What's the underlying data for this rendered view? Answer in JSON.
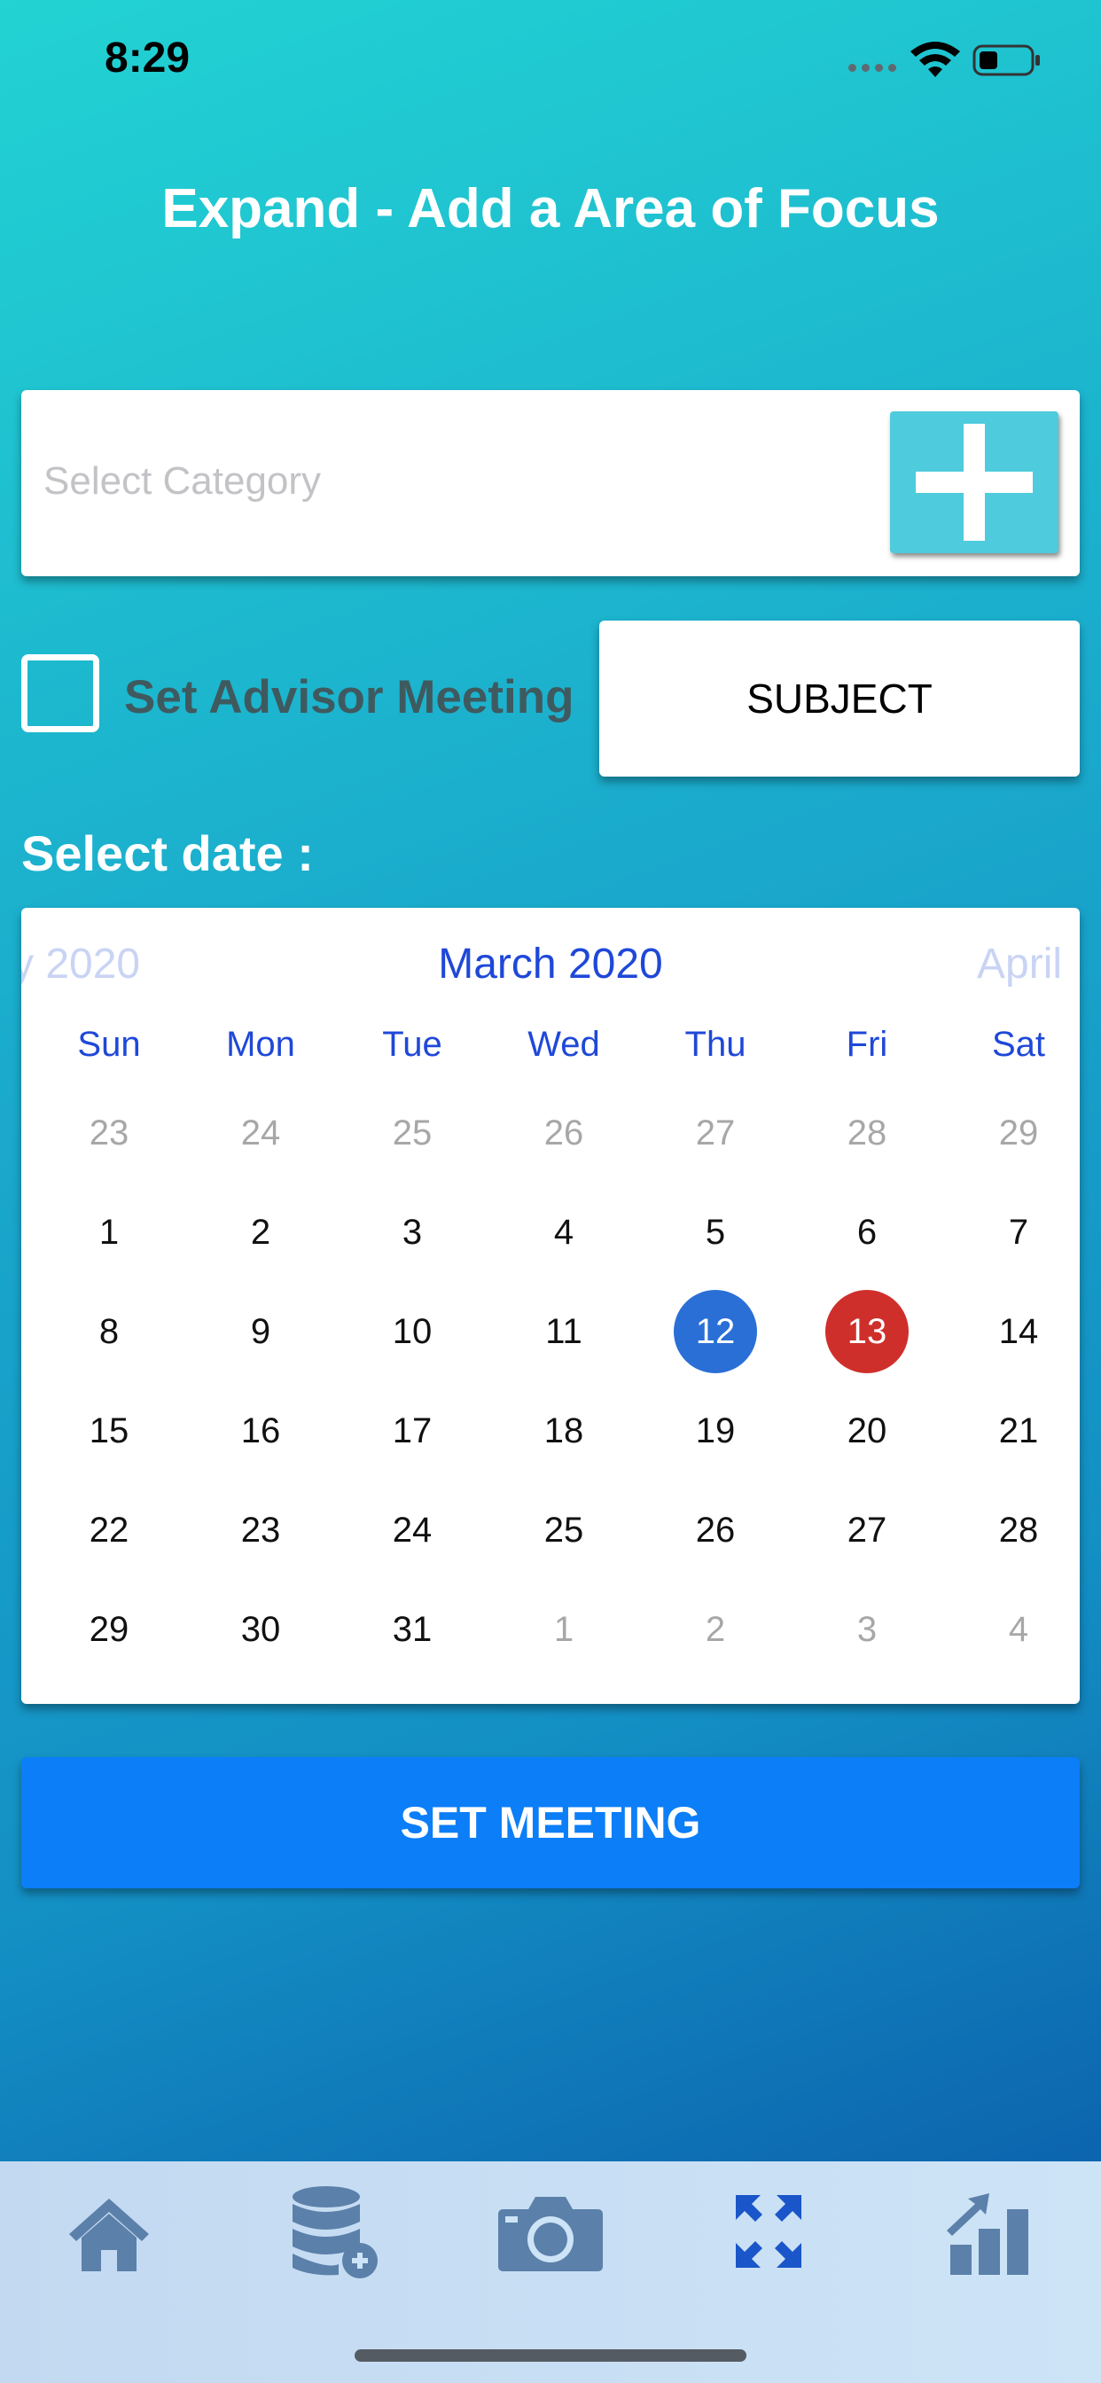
{
  "status_bar": {
    "time": "8:29"
  },
  "title": "Expand - Add a Area of Focus",
  "category": {
    "placeholder": "Select Category"
  },
  "advisor": {
    "label": "Set Advisor Meeting",
    "checked": false
  },
  "subject_button": "SUBJECT",
  "select_date_label": "Select date :",
  "calendar": {
    "prev_month": "y 2020",
    "current_month": "March 2020",
    "next_month": "April",
    "weekdays": [
      "Sun",
      "Mon",
      "Tue",
      "Wed",
      "Thu",
      "Fri",
      "Sat"
    ],
    "weeks": [
      [
        "23",
        "24",
        "25",
        "26",
        "27",
        "28",
        "29"
      ],
      [
        "1",
        "2",
        "3",
        "4",
        "5",
        "6",
        "7"
      ],
      [
        "8",
        "9",
        "10",
        "11",
        "12",
        "13",
        "14"
      ],
      [
        "15",
        "16",
        "17",
        "18",
        "19",
        "20",
        "21"
      ],
      [
        "22",
        "23",
        "24",
        "25",
        "26",
        "27",
        "28"
      ],
      [
        "29",
        "30",
        "31",
        "1",
        "2",
        "3",
        "4"
      ]
    ],
    "selected_day": "12",
    "today_day": "13",
    "colors": {
      "selected": "#2a6fd6",
      "today": "#cf2f2b",
      "header": "#1f48d8"
    }
  },
  "set_meeting_button": "SET MEETING",
  "tabs": [
    {
      "icon": "home-icon"
    },
    {
      "icon": "database-add-icon"
    },
    {
      "icon": "camera-icon"
    },
    {
      "icon": "expand-icon",
      "active": true
    },
    {
      "icon": "chart-growth-icon"
    }
  ]
}
